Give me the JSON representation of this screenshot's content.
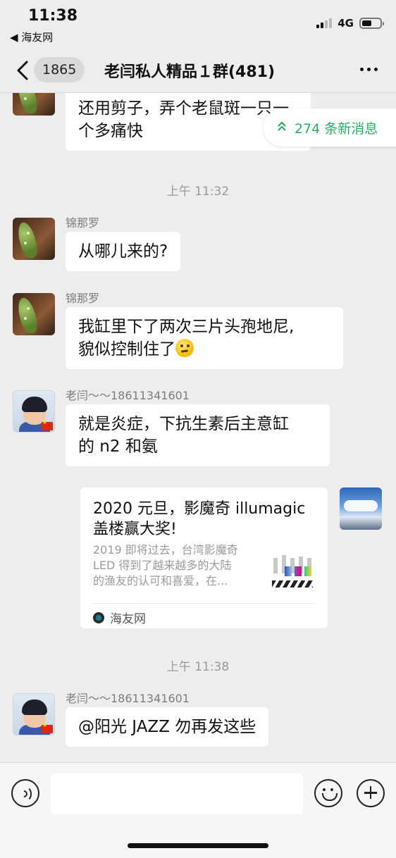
{
  "status_bar": {
    "time": "11:38",
    "back_app": "◀ 海友网",
    "network": "4G"
  },
  "nav": {
    "unread_count": "1865",
    "title": "老闫私人精品１群(481)"
  },
  "new_messages": {
    "label": "274 条新消息"
  },
  "messages": [
    {
      "sender": "",
      "text_lines": [
        "还用剪子，弄个老鼠斑一只一",
        "个多痛快"
      ]
    },
    {
      "timestamp": "上午 11:32"
    },
    {
      "sender": "锦那罗",
      "text": "从哪儿来的?"
    },
    {
      "sender": "锦那罗",
      "text_line1": "我缸里下了两次三片头孢地尼,",
      "text_line2": "貌似控制住了"
    },
    {
      "sender": "老闫～～18611341601",
      "text_line1": "就是炎症，下抗生素后主意缸",
      "text_line2": "的 n2 和氨"
    },
    {
      "card": {
        "title_line1": "2020 元旦，影魔奇 illumagic",
        "title_line2": "盖楼赢大奖!",
        "desc_line1": "2019 即将过去，台湾影魔奇",
        "desc_line2": "LED 得到了越来越多的大陆",
        "desc_line3": "的渔友的认可和喜爱，在...",
        "source": "海友网"
      }
    },
    {
      "timestamp": "上午 11:38"
    },
    {
      "sender": "老闫～～18611341601",
      "text": "@阳光 JAZZ 勿再发这些"
    }
  ],
  "colors": {
    "accent_green": "#2aae67",
    "background": "#ededed",
    "bubble": "#ffffff"
  },
  "icons": [
    "back-chevron-icon",
    "more-dots-icon",
    "chevron-double-up-icon",
    "voice-icon",
    "emoji-icon",
    "plus-icon"
  ]
}
